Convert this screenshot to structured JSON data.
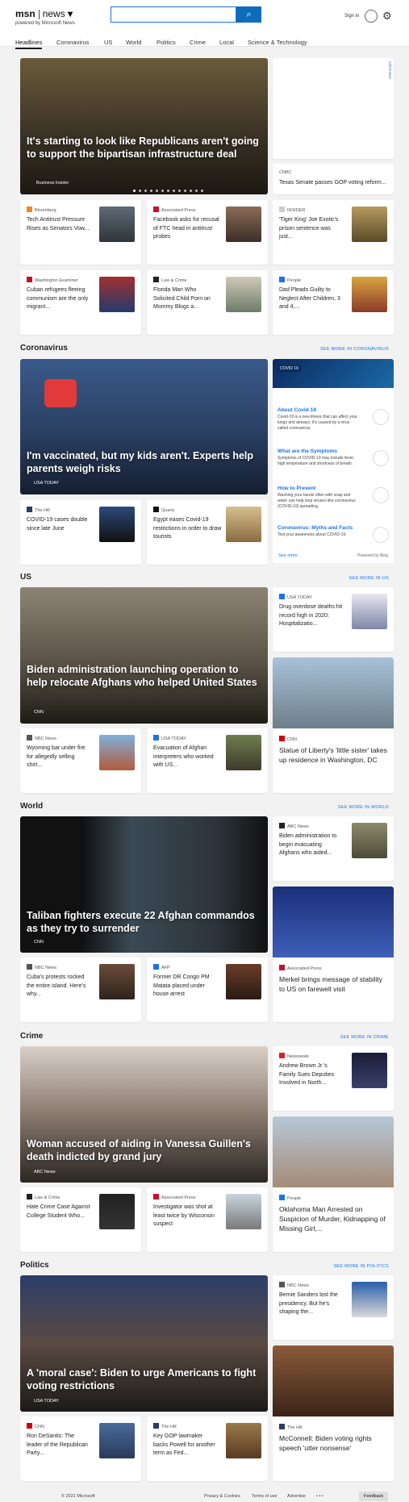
{
  "header": {
    "logo_msn": "msn",
    "logo_news": "news",
    "powered_by": "powered by Microsoft News",
    "sign_in": "Sign in"
  },
  "nav": [
    "Headlines",
    "Coronavirus",
    "US",
    "World",
    "Politics",
    "Crime",
    "Local",
    "Science & Technology"
  ],
  "top": {
    "hero": {
      "title": "It's starting to look like Republicans aren't going to support the bipartisan infrastructure deal",
      "source": "Business Insider"
    },
    "ad_label": "AdChoices",
    "side": {
      "source": "CNBC",
      "title": "Texas Senate passes GOP voting reform..."
    },
    "cards": [
      {
        "source": "Bloomberg",
        "title": "Tech Antitrust Pressure Rises as Senators Vow..."
      },
      {
        "source": "Associated Press",
        "title": "Facebook asks for recusal of FTC head in antitrust probes"
      },
      {
        "source": "INSIDER",
        "title": "'Tiger King' Joe Exotic's prison sentence was just..."
      },
      {
        "source": "Washington Examiner",
        "title": "Cuban refugees fleeing communism are the only migrant..."
      },
      {
        "source": "Law & Crime",
        "title": "Florida Man Who Solicited Child Porn on Mommy Blogs a..."
      },
      {
        "source": "People",
        "title": "Dad Pleads Guilty to Neglect After Children, 3 and 4,..."
      }
    ]
  },
  "coronavirus": {
    "heading": "Coronavirus",
    "see_more": "SEE MORE IN CORONAVIRUS",
    "hero": {
      "title": "I'm vaccinated, but my kids aren't. Experts help parents weigh risks",
      "source": "USA TODAY"
    },
    "cards": [
      {
        "source": "The Hill",
        "title": "COVID-19 cases double since late June"
      },
      {
        "source": "Quartz",
        "title": "Egypt eases Covid-19 restrictions in order to draw tourists"
      }
    ],
    "panel": {
      "tag": "COVID 19",
      "see_more": "See more",
      "powered": "Powered by Bing",
      "items": [
        {
          "title": "About Covid-19",
          "desc": "Covid-19 is a new illness that can affect your lungs and airways. It's caused by a virus called coronavirus."
        },
        {
          "title": "What are the Symptoms",
          "desc": "Symptoms of COVID-19 may include fever, high temperature and shortness of breath."
        },
        {
          "title": "How to Prevent",
          "desc": "Washing your hands often with soap and water can help stop viruses like coronavirus (COVID-19) spreading."
        },
        {
          "title": "Coronavirus: Myths and Facts",
          "desc": "Test your awareness about COVID-19."
        }
      ]
    }
  },
  "us": {
    "heading": "US",
    "see_more": "SEE MORE IN US",
    "hero": {
      "title": "Biden administration launching operation to help relocate Afghans who helped United States",
      "source": "CNN"
    },
    "side": {
      "source": "USA TODAY",
      "title": "Drug overdose deaths hit record high in 2020; Hospitalizatio..."
    },
    "tall": {
      "source": "CNN",
      "title": "Statue of Liberty's 'little sister' takes up residence in Washington, DC"
    },
    "cards": [
      {
        "source": "NBC News",
        "title": "Wyoming bar under fire for allegedly selling shirt..."
      },
      {
        "source": "USA TODAY",
        "title": "Evacuation of Afghan interpreters who worked with US..."
      }
    ]
  },
  "world": {
    "heading": "World",
    "see_more": "SEE MORE IN WORLD",
    "hero": {
      "title": "Taliban fighters execute 22 Afghan commandos as they try to surrender",
      "source": "CNN"
    },
    "side": {
      "source": "ABC News",
      "title": "Biden administration to begin evacuating Afghans who aided..."
    },
    "tall": {
      "source": "Associated Press",
      "title": "Merkel brings message of stability to US on farewell visit"
    },
    "cards": [
      {
        "source": "NBC News",
        "title": "Cuba's protests rocked the entire island. Here's why..."
      },
      {
        "source": "AFP",
        "title": "Former DR Congo PM Matata placed under house arrest"
      }
    ]
  },
  "crime": {
    "heading": "Crime",
    "see_more": "SEE MORE IN CRIME",
    "hero": {
      "title": "Woman accused of aiding in Vanessa Guillen's death indicted by grand jury",
      "source": "ABC News"
    },
    "side": {
      "source": "Newsweek",
      "title": "Andrew Brown Jr.'s Family Sues Deputies Involved in North..."
    },
    "tall": {
      "source": "People",
      "title": "Oklahoma Man Arrested on Suspicion of Murder, Kidnapping of Missing Girl,..."
    },
    "cards": [
      {
        "source": "Law & Crime",
        "title": "Hate Crime Case Against College Student Who..."
      },
      {
        "source": "Associated Press",
        "title": "Investigator was shot at least twice by Wisconsin suspect"
      }
    ]
  },
  "politics": {
    "heading": "Politics",
    "see_more": "SEE MORE IN POLITICS",
    "hero": {
      "title": "A 'moral case': Biden to urge Americans to fight voting restrictions",
      "source": "USA TODAY"
    },
    "side": {
      "source": "NBC News",
      "title": "Bernie Sanders lost the presidency. But he's shaping the..."
    },
    "tall": {
      "source": "The Hill",
      "title": "McConnell: Biden voting rights speech 'utter nonsense'"
    },
    "cards": [
      {
        "source": "CNN",
        "title": "Ron DeSantis: The leader of the Republican Party..."
      },
      {
        "source": "The Hill",
        "title": "Key GOP lawmaker backs Powell for another term as Fed..."
      }
    ]
  },
  "footer": {
    "copyright": "© 2021 Microsoft",
    "privacy": "Privacy & Cookies",
    "terms": "Terms of use",
    "advertise": "Advertise",
    "more": "• • •",
    "feedback": "Feedback"
  }
}
